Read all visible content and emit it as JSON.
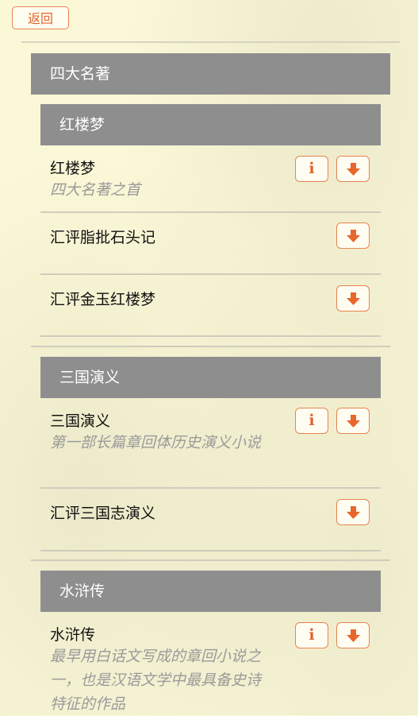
{
  "nav": {
    "back_label": "返回"
  },
  "category": {
    "title": "四大名著"
  },
  "icons": {
    "info_glyph": "i",
    "info": "info-icon",
    "download": "download-arrow-icon"
  },
  "colors": {
    "accent": "#e8844e",
    "header_bg": "#8e8e8e",
    "background": "#fbf8d8"
  },
  "sections": [
    {
      "title": "红楼梦",
      "items": [
        {
          "title": "红楼梦",
          "desc": "四大名著之首",
          "has_info": true
        },
        {
          "title": "汇评脂批石头记",
          "desc": "",
          "has_info": false
        },
        {
          "title": "汇评金玉红楼梦",
          "desc": "",
          "has_info": false
        }
      ]
    },
    {
      "title": "三国演义",
      "items": [
        {
          "title": "三国演义",
          "desc": "第一部长篇章回体历史演义小说",
          "has_info": true
        },
        {
          "title": "汇评三国志演义",
          "desc": "",
          "has_info": false
        }
      ]
    },
    {
      "title": "水浒传",
      "items": [
        {
          "title": "水浒传",
          "desc": "最早用白话文写成的章回小说之一，也是汉语文学中最具备史诗特征的作品",
          "has_info": true
        }
      ]
    }
  ]
}
